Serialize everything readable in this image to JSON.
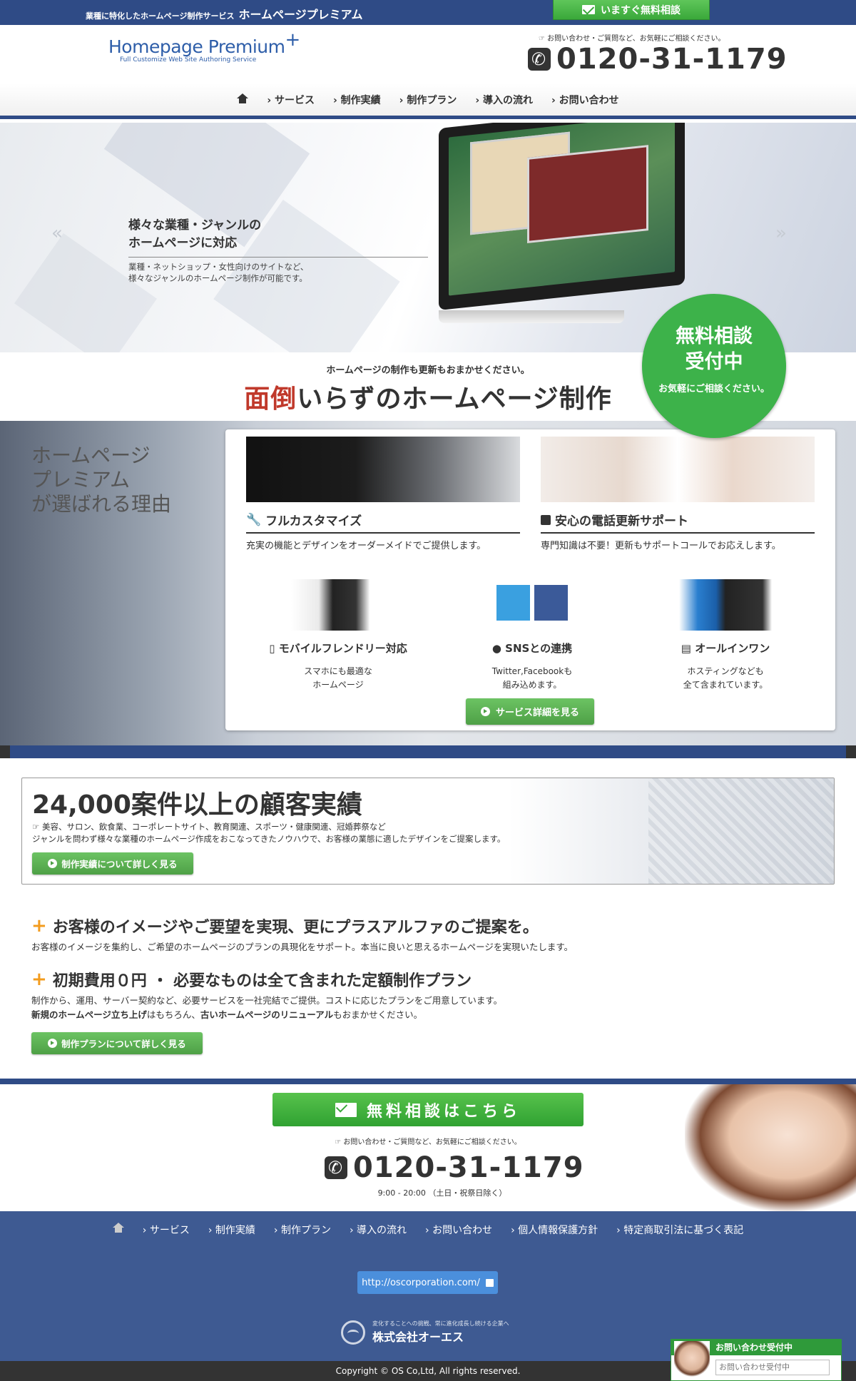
{
  "topbar": {
    "tagline": "業種に特化したホームページ制作サービス",
    "brand": "ホームページプレミアム",
    "consult_button": "いますぐ無料相談"
  },
  "header": {
    "logo_main": "Homepage Premium",
    "logo_sub": "Full Customize Web Site Authoring Service",
    "contact_note": "お問い合わせ・ご質問など、お気軽にご相談ください。",
    "phone": "0120-31-1179"
  },
  "nav": {
    "items": [
      "サービス",
      "制作実績",
      "制作プラン",
      "導入の流れ",
      "お問い合わせ"
    ]
  },
  "hero": {
    "title_line1": "様々な業種・ジャンルの",
    "title_line2": "ホームページに対応",
    "desc_line1": "業種・ネットショップ・女性向けのサイトなど、",
    "desc_line2": "様々なジャンルのホームページ制作が可能です。",
    "prev": "«",
    "next": "»"
  },
  "free_circle": {
    "line1": "無料相談",
    "line2": "受付中",
    "line3": "お気軽にご相談ください。"
  },
  "band": {
    "sub": "ホームページの制作も更新もおまかせください。",
    "main_em": "面倒",
    "main_rest": "いらずのホームページ制作"
  },
  "reasons": {
    "title_line1": "ホームページ",
    "title_line2": "プレミアム",
    "title_line3": "が選ばれる理由",
    "feature1": {
      "title": "フルカスタマイズ",
      "desc": "充実の機能とデザインをオーダーメイドでご提供します。"
    },
    "feature2": {
      "title": "安心の電話更新サポート",
      "desc": "専門知識は不要！更新もサポートコールでお応えします。"
    },
    "mini1": {
      "title": "モバイルフレンドリー対応",
      "desc1": "スマホにも最適な",
      "desc2": "ホームページ"
    },
    "mini2": {
      "title": "SNSとの連携",
      "desc1": "Twitter,Facebookも",
      "desc2": "組み込めます。"
    },
    "mini3": {
      "title": "オールインワン",
      "desc1": "ホスティングなども",
      "desc2": "全て含まれています。"
    },
    "button": "サービス詳細を見る"
  },
  "records": {
    "title": "24,000案件以上の顧客実績",
    "line1": "美容、サロン、飲食業、コーポレートサイト、教育関連、スポーツ・健康関連、冠婚葬祭など",
    "line2": "ジャンルを問わず様々な業種のホームページ作成をおこなってきたノウハウで、お客様の業態に適したデザインをご提案します。",
    "button": "制作実績について詳しく見る"
  },
  "proposal": {
    "title": "お客様のイメージやご要望を実現、更にプラスアルファのご提案を。",
    "desc": "お客様のイメージを集約し、ご希望のホームページのプランの具現化をサポート。本当に良いと思えるホームページを実現いたします。"
  },
  "plan": {
    "title": "初期費用０円 ・ 必要なものは全て含まれた定額制作プラン",
    "desc1": "制作から、運用、サーバー契約など、必要サービスを一社完結でご提供。コストに応じたプランをご用意しています。",
    "desc2_b1": "新規のホームページ立ち上げ",
    "desc2_t1": "はもちろん、",
    "desc2_b2": "古いホームページのリニューアル",
    "desc2_t2": "もおまかせください。",
    "button": "制作プランについて詳しく見る"
  },
  "cta": {
    "button": "無料相談はこちら",
    "note": "お問い合わせ・ご質問など、お気軽にご相談ください。",
    "phone": "0120-31-1179",
    "hours": "9:00 - 20:00 （土日・祝祭日除く）"
  },
  "footer": {
    "nav": [
      "サービス",
      "制作実績",
      "制作プラン",
      "導入の流れ",
      "お問い合わせ",
      "個人情報保護方針",
      "特定商取引法に基づく表記"
    ],
    "url": "http://oscorporation.com/",
    "corp_tag": "変化することへの挑戦、常に進化成長し続ける企業へ",
    "corp_name": "株式会社オーエス",
    "copyright": "Copyright © OS Co,Ltd, All rights reserved."
  },
  "chat": {
    "title": "お問い合わせ受付中",
    "placeholder": "お問い合わせ受付中"
  },
  "colors": {
    "brand_navy": "#2f4b86",
    "accent_green": "#3db24a",
    "accent_orange": "#f39c1f",
    "accent_red": "#c0392b"
  }
}
